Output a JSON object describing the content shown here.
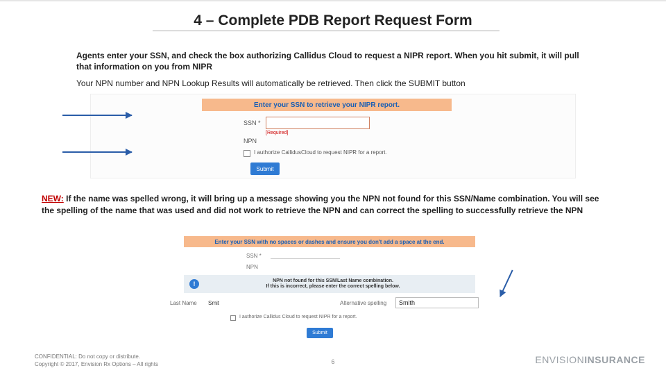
{
  "title": "4 – Complete PDB Report Request Form",
  "intro1": "Agents enter your SSN, and check the box authorizing Callidus Cloud to request a NIPR report.  When you hit submit, it will pull that information on you from NIPR",
  "intro2": "Your NPN number and NPN Lookup Results will automatically be retrieved.  Then click the SUBMIT button",
  "shot1": {
    "bar": "Enter your SSN to retrieve your NIPR report.",
    "ssn_label": "SSN *",
    "required": "[Required]",
    "npn_label": "NPN",
    "checkbox_label": "I authorize CallidusCloud to request NIPR for a report.",
    "submit": "Submit"
  },
  "new_label": "NEW:",
  "new_text": " If the name was spelled wrong, it will bring up a message showing you the NPN not found for this SSN/Name combination.   You will see the spelling of the name that was used and did not work to retrieve the NPN and can correct the spelling to successfully retrieve the NPN",
  "shot2": {
    "bar": "Enter your SSN with no spaces or dashes and ensure you don't add a space at the end.",
    "ssn_label": "SSN *",
    "npn_label": "NPN",
    "notice_line1": "NPN not found for this SSN/Last Name combination.",
    "notice_line2": "If this is incorrect, please enter the correct spelling below.",
    "last_label": "Last Name",
    "last_value": "Smit",
    "alt_label": "Alternative spelling",
    "alt_value": "Smith",
    "checkbox_label": "I authorize Callidus Cloud to request NIPR for a report.",
    "submit": "Submit"
  },
  "footer": {
    "line1": "CONFIDENTIAL: Do not copy or distribute.",
    "line2": "Copyright © 2017, Envision Rx Options – All rights"
  },
  "page_number": "6",
  "brand_thin": "ENVISION",
  "brand_bold": "INSURANCE"
}
